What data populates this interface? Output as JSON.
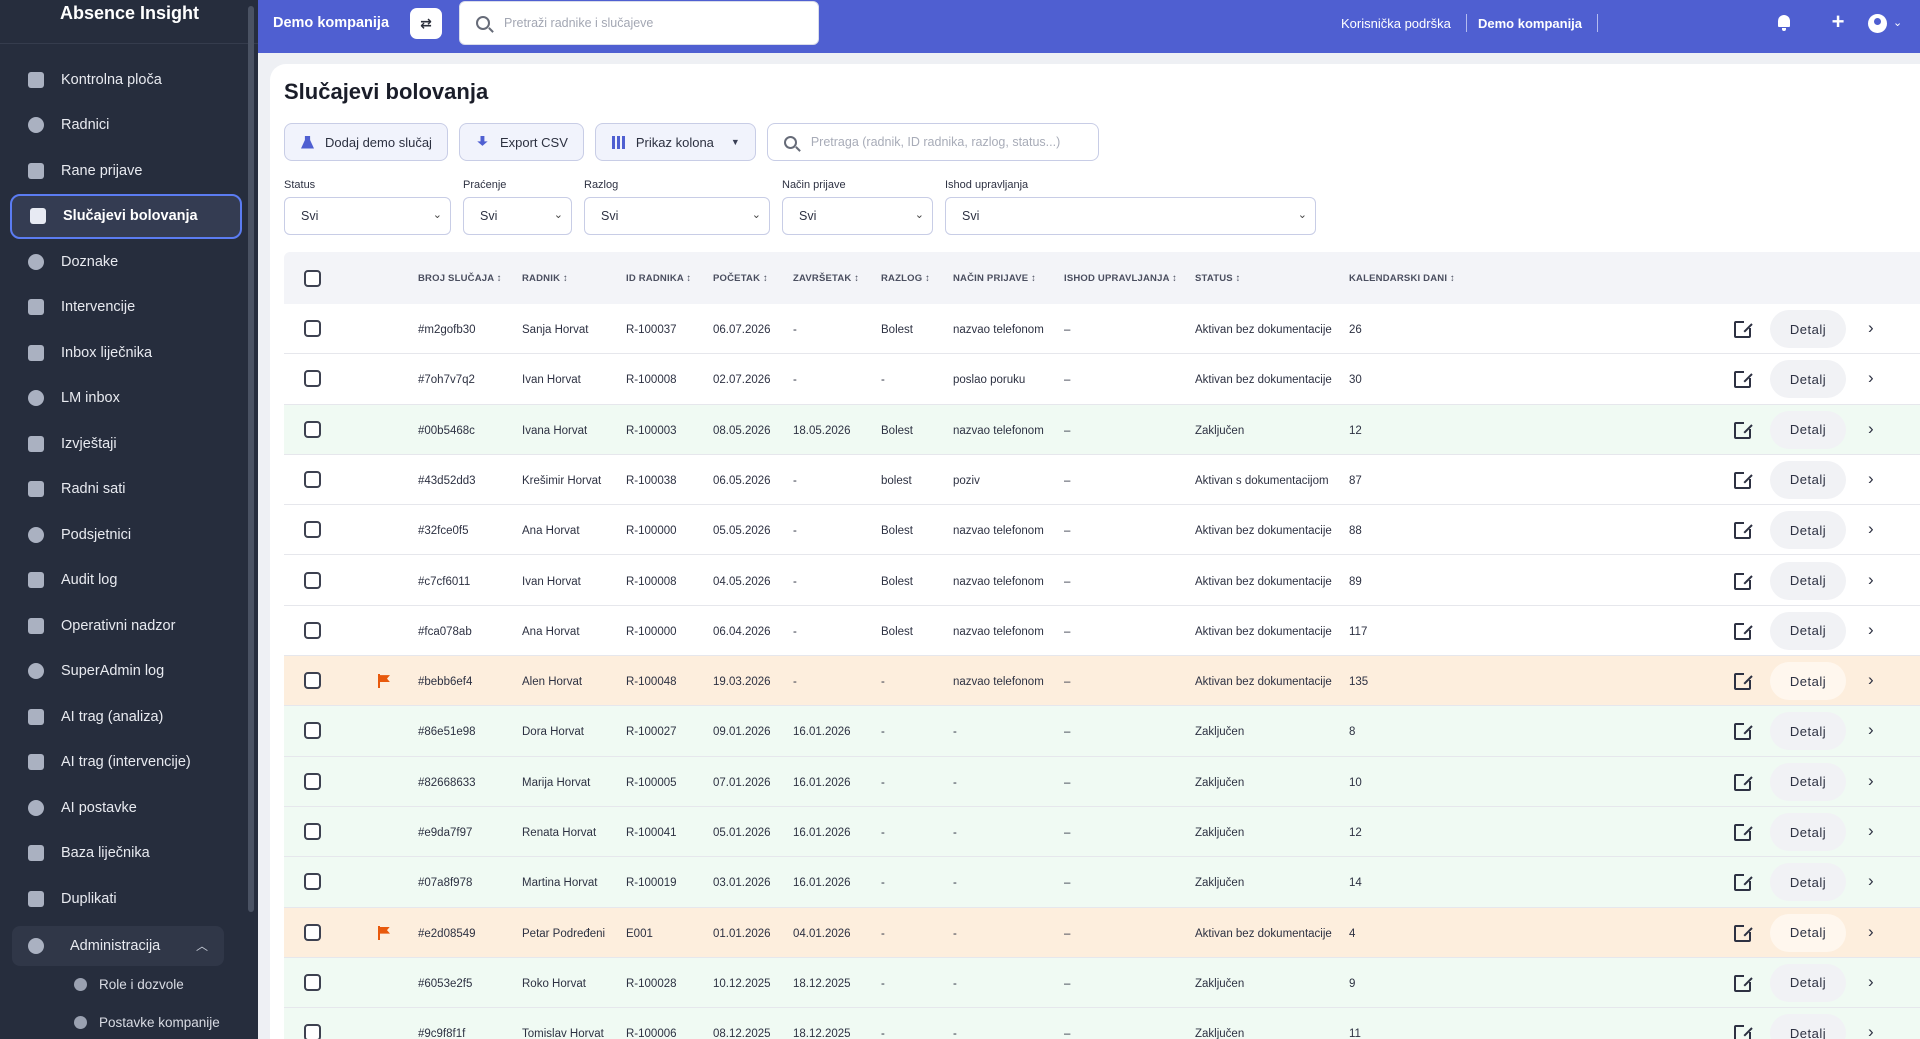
{
  "sidebar": {
    "title": "Absence Insight",
    "items": [
      {
        "label": "Kontrolna ploča",
        "icon": "dashboard-icon",
        "active": false
      },
      {
        "label": "Radnici",
        "icon": "people-icon",
        "active": false
      },
      {
        "label": "Rane prijave",
        "icon": "calendar-icon",
        "active": false
      },
      {
        "label": "Slučajevi bolovanja",
        "icon": "medical-bag-icon",
        "active": true
      },
      {
        "label": "Doznake",
        "icon": "document-icon",
        "active": false
      },
      {
        "label": "Intervencije",
        "icon": "handshake-icon",
        "active": false
      },
      {
        "label": "Inbox liječnika",
        "icon": "inbox-icon",
        "active": false
      },
      {
        "label": "LM inbox",
        "icon": "chat-icon",
        "active": false
      },
      {
        "label": "Izvještaji",
        "icon": "chart-icon",
        "active": false
      },
      {
        "label": "Radni sati",
        "icon": "clock-icon",
        "active": false
      },
      {
        "label": "Podsjetnici",
        "icon": "alarm-icon",
        "active": false
      },
      {
        "label": "Audit log",
        "icon": "history-icon",
        "active": false
      },
      {
        "label": "Operativni nadzor",
        "icon": "monitor-icon",
        "active": false
      },
      {
        "label": "SuperAdmin log",
        "icon": "shield-icon",
        "active": false
      },
      {
        "label": "AI trag (analiza)",
        "icon": "network-icon",
        "active": false
      },
      {
        "label": "AI trag (intervencije)",
        "icon": "medical-bag-icon",
        "active": false
      },
      {
        "label": "AI postavke",
        "icon": "sliders-icon",
        "active": false
      },
      {
        "label": "Baza liječnika",
        "icon": "medical-bag-icon",
        "active": false
      },
      {
        "label": "Duplikati",
        "icon": "copy-icon",
        "active": false
      }
    ],
    "group": {
      "label": "Administracija",
      "icon": "shield-gear-icon"
    },
    "sub_items": [
      {
        "label": "Role i dozvole",
        "icon": "shield-icon"
      },
      {
        "label": "Postavke kompanije",
        "icon": "building-icon"
      }
    ]
  },
  "topbar": {
    "company": "Demo kompanija",
    "search_placeholder": "Pretraži radnike i slučajeve",
    "support": "Korisnička podrška",
    "company_right": "Demo kompanija"
  },
  "page": {
    "title": "Slučajevi bolovanja",
    "buttons": {
      "add_demo": "Dodaj demo slučaj",
      "export": "Export CSV",
      "columns": "Prikaz kolona"
    },
    "search_placeholder": "Pretraga (radnik, ID radnika, razlog, status...)"
  },
  "filters": [
    {
      "label": "Status",
      "value": "Svi"
    },
    {
      "label": "Praćenje",
      "value": "Svi"
    },
    {
      "label": "Razlog",
      "value": "Svi"
    },
    {
      "label": "Način prijave",
      "value": "Svi"
    },
    {
      "label": "Ishod upravljanja",
      "value": "Svi"
    }
  ],
  "table": {
    "columns": [
      "BROJ SLUČAJA ↕",
      "RADNIK ↕",
      "ID RADNIKA ↕",
      "POČETAK ↕",
      "ZAVRŠETAK ↕",
      "RAZLOG ↕",
      "NAČIN PRIJAVE ↕",
      "ISHOD UPRAVLJANJA ↕",
      "STATUS ↕",
      "KALENDARSKI DANI ↕"
    ],
    "details_label": "Detalj",
    "rows": [
      {
        "tone": "white",
        "flag": false,
        "case": "#m2gofb30",
        "worker": "Sanja Horvat",
        "worker_id": "R-100037",
        "start": "06.07.2026",
        "end": "-",
        "reason": "Bolest",
        "method": "nazvao telefonom",
        "outcome": "–",
        "status": "Aktivan bez dokumentacije",
        "days": "26"
      },
      {
        "tone": "white",
        "flag": false,
        "case": "#7oh7v7q2",
        "worker": "Ivan Horvat",
        "worker_id": "R-100008",
        "start": "02.07.2026",
        "end": "-",
        "reason": "-",
        "method": "poslao poruku",
        "outcome": "–",
        "status": "Aktivan bez dokumentacije",
        "days": "30"
      },
      {
        "tone": "green",
        "flag": false,
        "case": "#00b5468c",
        "worker": "Ivana Horvat",
        "worker_id": "R-100003",
        "start": "08.05.2026",
        "end": "18.05.2026",
        "reason": "Bolest",
        "method": "nazvao telefonom",
        "outcome": "–",
        "status": "Zaključen",
        "days": "12"
      },
      {
        "tone": "white",
        "flag": false,
        "case": "#43d52dd3",
        "worker": "Krešimir Horvat",
        "worker_id": "R-100038",
        "start": "06.05.2026",
        "end": "-",
        "reason": "bolest",
        "method": "poziv",
        "outcome": "–",
        "status": "Aktivan s dokumentacijom",
        "days": "87"
      },
      {
        "tone": "white",
        "flag": false,
        "case": "#32fce0f5",
        "worker": "Ana Horvat",
        "worker_id": "R-100000",
        "start": "05.05.2026",
        "end": "-",
        "reason": "Bolest",
        "method": "nazvao telefonom",
        "outcome": "–",
        "status": "Aktivan bez dokumentacije",
        "days": "88"
      },
      {
        "tone": "white",
        "flag": false,
        "case": "#c7cf6011",
        "worker": "Ivan Horvat",
        "worker_id": "R-100008",
        "start": "04.05.2026",
        "end": "-",
        "reason": "Bolest",
        "method": "nazvao telefonom",
        "outcome": "–",
        "status": "Aktivan bez dokumentacije",
        "days": "89"
      },
      {
        "tone": "white",
        "flag": false,
        "case": "#fca078ab",
        "worker": "Ana Horvat",
        "worker_id": "R-100000",
        "start": "06.04.2026",
        "end": "-",
        "reason": "Bolest",
        "method": "nazvao telefonom",
        "outcome": "–",
        "status": "Aktivan bez dokumentacije",
        "days": "117"
      },
      {
        "tone": "orange",
        "flag": true,
        "case": "#bebb6ef4",
        "worker": "Alen Horvat",
        "worker_id": "R-100048",
        "start": "19.03.2026",
        "end": "-",
        "reason": "-",
        "method": "nazvao telefonom",
        "outcome": "–",
        "status": "Aktivan bez dokumentacije",
        "days": "135"
      },
      {
        "tone": "green",
        "flag": false,
        "case": "#86e51e98",
        "worker": "Dora Horvat",
        "worker_id": "R-100027",
        "start": "09.01.2026",
        "end": "16.01.2026",
        "reason": "-",
        "method": "-",
        "outcome": "–",
        "status": "Zaključen",
        "days": "8"
      },
      {
        "tone": "green",
        "flag": false,
        "case": "#82668633",
        "worker": "Marija Horvat",
        "worker_id": "R-100005",
        "start": "07.01.2026",
        "end": "16.01.2026",
        "reason": "-",
        "method": "-",
        "outcome": "–",
        "status": "Zaključen",
        "days": "10"
      },
      {
        "tone": "green",
        "flag": false,
        "case": "#e9da7f97",
        "worker": "Renata Horvat",
        "worker_id": "R-100041",
        "start": "05.01.2026",
        "end": "16.01.2026",
        "reason": "-",
        "method": "-",
        "outcome": "–",
        "status": "Zaključen",
        "days": "12"
      },
      {
        "tone": "green",
        "flag": false,
        "case": "#07a8f978",
        "worker": "Martina Horvat",
        "worker_id": "R-100019",
        "start": "03.01.2026",
        "end": "16.01.2026",
        "reason": "-",
        "method": "-",
        "outcome": "–",
        "status": "Zaključen",
        "days": "14"
      },
      {
        "tone": "orange",
        "flag": true,
        "case": "#e2d08549",
        "worker": "Petar Podređeni",
        "worker_id": "E001",
        "start": "01.01.2026",
        "end": "04.01.2026",
        "reason": "-",
        "method": "-",
        "outcome": "–",
        "status": "Aktivan bez dokumentacije",
        "days": "4"
      },
      {
        "tone": "green",
        "flag": false,
        "case": "#6053e2f5",
        "worker": "Roko Horvat",
        "worker_id": "R-100028",
        "start": "10.12.2025",
        "end": "18.12.2025",
        "reason": "-",
        "method": "-",
        "outcome": "–",
        "status": "Zaključen",
        "days": "9"
      },
      {
        "tone": "green",
        "flag": false,
        "case": "#9c9f8f1f",
        "worker": "Tomislav Horvat",
        "worker_id": "R-100006",
        "start": "08.12.2025",
        "end": "18.12.2025",
        "reason": "-",
        "method": "-",
        "outcome": "–",
        "status": "Zaključen",
        "days": "11"
      }
    ]
  }
}
